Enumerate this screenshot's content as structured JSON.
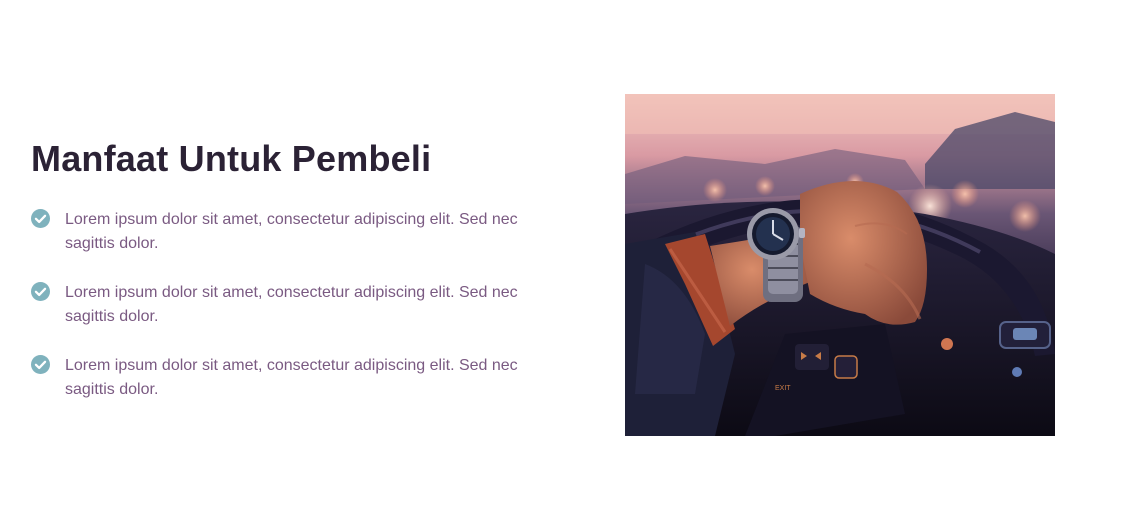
{
  "heading": "Manfaat Untuk Pembeli",
  "benefits": [
    {
      "text": "Lorem ipsum dolor sit amet, consectetur adipiscing elit. Sed nec sagittis dolor.",
      "icon": "check-circle-icon"
    },
    {
      "text": "Lorem ipsum dolor sit amet, consectetur adipiscing elit. Sed nec sagittis dolor.",
      "icon": "check-circle-icon"
    },
    {
      "text": "Lorem ipsum dolor sit amet, consectetur adipiscing elit. Sed nec sagittis dolor.",
      "icon": "check-circle-icon"
    }
  ],
  "colors": {
    "heading": "#2b2235",
    "body_text": "#7a5a82",
    "check_icon": "#7fb2bd"
  }
}
